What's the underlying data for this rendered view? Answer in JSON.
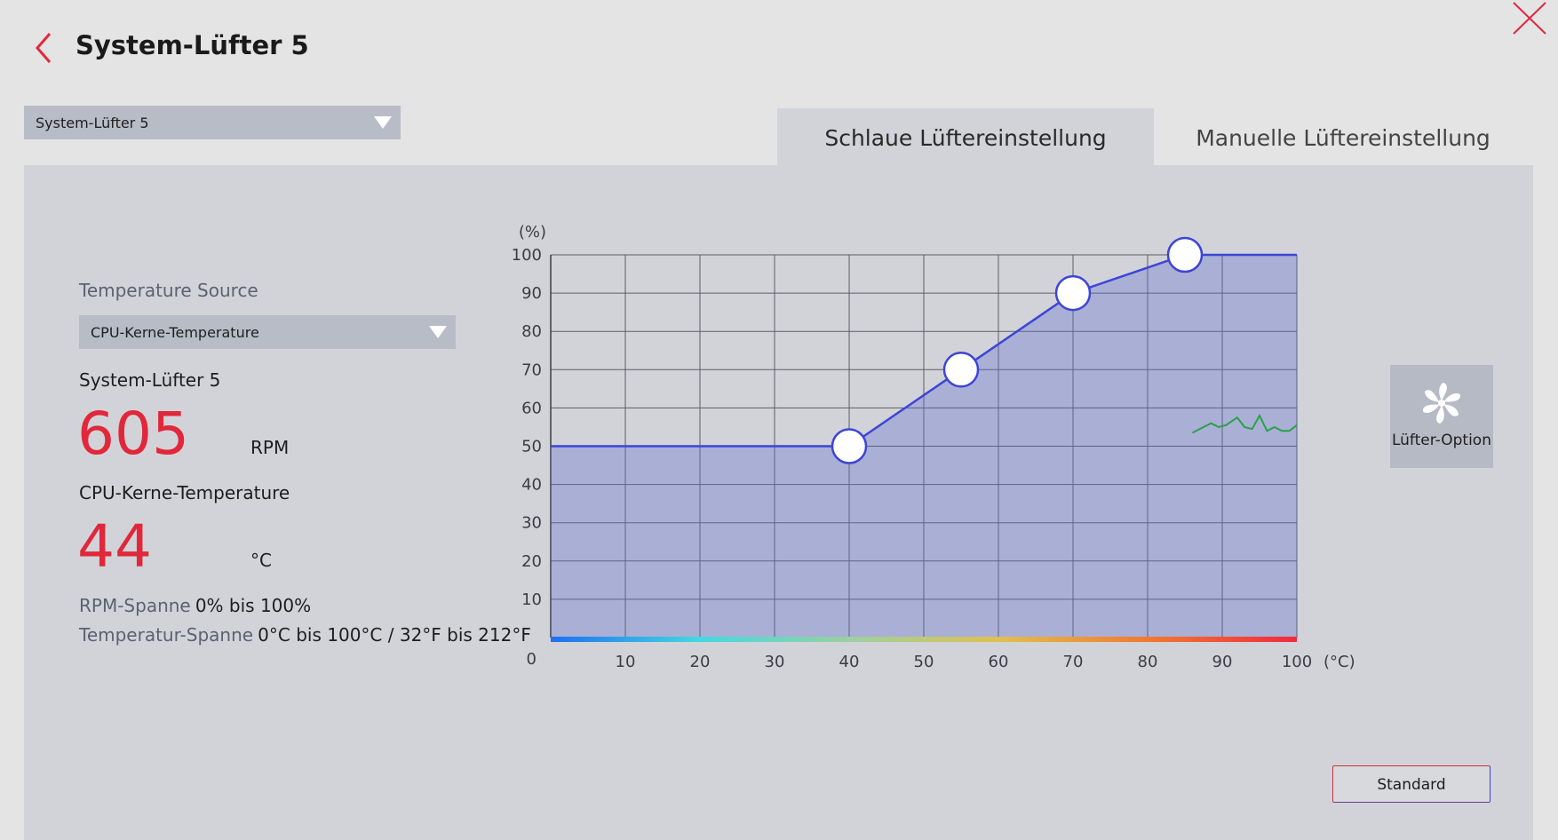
{
  "header": {
    "title": "System-Lüfter 5"
  },
  "fan_selector": {
    "value": "System-Lüfter 5"
  },
  "tabs": [
    {
      "label": "Schlaue Lüftereinstellung",
      "active": true
    },
    {
      "label": "Manuelle Lüftereinstellung",
      "active": false
    }
  ],
  "info": {
    "temp_source_label": "Temperature Source",
    "temp_source_value": "CPU-Kerne-Temperature",
    "fan_name": "System-Lüfter 5",
    "rpm_value": "605",
    "rpm_unit": "RPM",
    "temp_name": "CPU-Kerne-Temperature",
    "temp_value": "44",
    "temp_unit": "°C",
    "rpm_range_label": "RPM-Spanne",
    "rpm_range_value": "0% bis 100%",
    "temp_range_label": "Temperatur-Spanne",
    "temp_range_value": "0°C bis 100°C / 32°F bis 212°F"
  },
  "chart_data": {
    "type": "line",
    "ylabel": "(%)",
    "xlabel": "(°C)",
    "xlim": [
      0,
      100
    ],
    "ylim": [
      0,
      100
    ],
    "x_ticks": [
      "10",
      "20",
      "30",
      "40",
      "50",
      "60",
      "70",
      "80",
      "90",
      "100"
    ],
    "y_ticks": [
      "10",
      "20",
      "30",
      "40",
      "50",
      "60",
      "70",
      "80",
      "90",
      "100"
    ],
    "origin_label": "0",
    "grid": true,
    "fan_curve": {
      "x": [
        0,
        40,
        55,
        70,
        85,
        100
      ],
      "y": [
        50,
        50,
        70,
        90,
        100,
        100
      ]
    },
    "control_points": [
      {
        "x": 40,
        "y": 50
      },
      {
        "x": 55,
        "y": 70
      },
      {
        "x": 70,
        "y": 90
      },
      {
        "x": 85,
        "y": 100
      }
    ],
    "live_trace": {
      "x": [
        86,
        87.5,
        88.5,
        89.5,
        90.5,
        92,
        93,
        94,
        95,
        96,
        97,
        98,
        99,
        100
      ],
      "y": [
        53.5,
        55,
        56,
        55,
        55.5,
        57.5,
        55,
        54.5,
        58,
        54,
        55,
        54,
        54,
        55.5
      ]
    },
    "colors": {
      "curve": "#3d45d6",
      "fill": "rgba(96,110,210,0.35)",
      "grid": "#5a5e68",
      "trace": "#2aa14a",
      "gradient": [
        "#1e6ff0",
        "#43d9e0",
        "#9bd0a0",
        "#e0c050",
        "#f07a30",
        "#f02a40"
      ]
    }
  },
  "fan_option": {
    "label": "Lüfter-Option",
    "icon": "fan-icon"
  },
  "footer": {
    "standard_label": "Standard"
  },
  "colors": {
    "accent_red": "#e0283a",
    "panel_bg": "#d2d3d8",
    "page_bg": "#e4e4e5"
  }
}
